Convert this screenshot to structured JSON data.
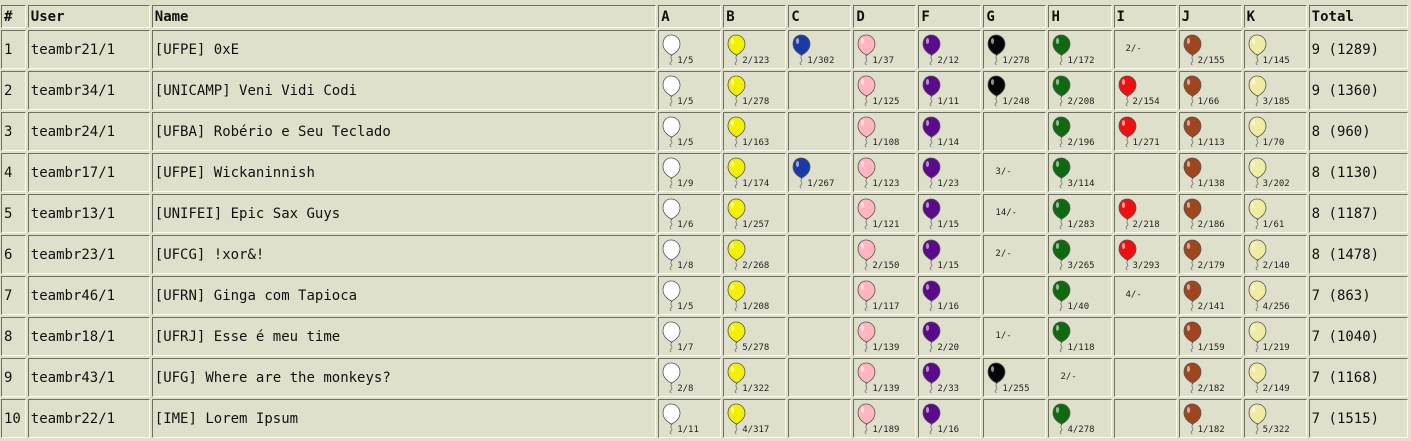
{
  "headers": {
    "rank": "#",
    "user": "User",
    "name": "Name",
    "total": "Total"
  },
  "problems": [
    {
      "letter": "A",
      "color": "#ffffff",
      "color_name": "white"
    },
    {
      "letter": "B",
      "color": "#f2f200",
      "color_name": "yellow"
    },
    {
      "letter": "C",
      "color": "#1a3aa8",
      "color_name": "blue"
    },
    {
      "letter": "D",
      "color": "#ffb6c1",
      "color_name": "pink"
    },
    {
      "letter": "F",
      "color": "#5a0a8a",
      "color_name": "purple"
    },
    {
      "letter": "G",
      "color": "#050505",
      "color_name": "black"
    },
    {
      "letter": "H",
      "color": "#0f6a0f",
      "color_name": "green"
    },
    {
      "letter": "I",
      "color": "#ee1010",
      "color_name": "red"
    },
    {
      "letter": "J",
      "color": "#a0461e",
      "color_name": "brown"
    },
    {
      "letter": "K",
      "color": "#f0eca4",
      "color_name": "light-yellow"
    }
  ],
  "rows": [
    {
      "rank": "1",
      "user": "teambr21/1",
      "name": "[UFPE] 0xE",
      "total": "9 (1289)",
      "cells": [
        {
          "solved": true,
          "text": "1/5"
        },
        {
          "solved": true,
          "text": "2/123"
        },
        {
          "solved": true,
          "text": "1/302"
        },
        {
          "solved": true,
          "text": "1/37"
        },
        {
          "solved": true,
          "text": "2/12"
        },
        {
          "solved": true,
          "text": "1/278"
        },
        {
          "solved": true,
          "text": "1/172"
        },
        {
          "solved": false,
          "text": "2/-"
        },
        {
          "solved": true,
          "text": "2/155"
        },
        {
          "solved": true,
          "text": "1/145"
        }
      ]
    },
    {
      "rank": "2",
      "user": "teambr34/1",
      "name": "[UNICAMP] Veni Vidi Codi",
      "total": "9 (1360)",
      "cells": [
        {
          "solved": true,
          "text": "1/5"
        },
        {
          "solved": true,
          "text": "1/278"
        },
        {
          "solved": false,
          "text": ""
        },
        {
          "solved": true,
          "text": "1/125"
        },
        {
          "solved": true,
          "text": "1/11"
        },
        {
          "solved": true,
          "text": "1/248"
        },
        {
          "solved": true,
          "text": "2/208"
        },
        {
          "solved": true,
          "text": "2/154"
        },
        {
          "solved": true,
          "text": "1/66"
        },
        {
          "solved": true,
          "text": "3/185"
        }
      ]
    },
    {
      "rank": "3",
      "user": "teambr24/1",
      "name": "[UFBA] Robério e Seu Teclado",
      "total": "8 (960)",
      "cells": [
        {
          "solved": true,
          "text": "1/5"
        },
        {
          "solved": true,
          "text": "1/163"
        },
        {
          "solved": false,
          "text": ""
        },
        {
          "solved": true,
          "text": "1/108"
        },
        {
          "solved": true,
          "text": "1/14"
        },
        {
          "solved": false,
          "text": ""
        },
        {
          "solved": true,
          "text": "2/196"
        },
        {
          "solved": true,
          "text": "1/271"
        },
        {
          "solved": true,
          "text": "1/113"
        },
        {
          "solved": true,
          "text": "1/70"
        }
      ]
    },
    {
      "rank": "4",
      "user": "teambr17/1",
      "name": "[UFPE] Wickaninnish",
      "total": "8 (1130)",
      "cells": [
        {
          "solved": true,
          "text": "1/9"
        },
        {
          "solved": true,
          "text": "1/174"
        },
        {
          "solved": true,
          "text": "1/267"
        },
        {
          "solved": true,
          "text": "1/123"
        },
        {
          "solved": true,
          "text": "1/23"
        },
        {
          "solved": false,
          "text": "3/-"
        },
        {
          "solved": true,
          "text": "3/114"
        },
        {
          "solved": false,
          "text": ""
        },
        {
          "solved": true,
          "text": "1/138"
        },
        {
          "solved": true,
          "text": "3/202"
        }
      ]
    },
    {
      "rank": "5",
      "user": "teambr13/1",
      "name": "[UNIFEI] Epic Sax Guys",
      "total": "8 (1187)",
      "cells": [
        {
          "solved": true,
          "text": "1/6"
        },
        {
          "solved": true,
          "text": "1/257"
        },
        {
          "solved": false,
          "text": ""
        },
        {
          "solved": true,
          "text": "1/121"
        },
        {
          "solved": true,
          "text": "1/15"
        },
        {
          "solved": false,
          "text": "14/-"
        },
        {
          "solved": true,
          "text": "1/283"
        },
        {
          "solved": true,
          "text": "2/218"
        },
        {
          "solved": true,
          "text": "2/186"
        },
        {
          "solved": true,
          "text": "1/61"
        }
      ]
    },
    {
      "rank": "6",
      "user": "teambr23/1",
      "name": "[UFCG] !xor&!",
      "total": "8 (1478)",
      "cells": [
        {
          "solved": true,
          "text": "1/8"
        },
        {
          "solved": true,
          "text": "2/268"
        },
        {
          "solved": false,
          "text": ""
        },
        {
          "solved": true,
          "text": "2/150"
        },
        {
          "solved": true,
          "text": "1/15"
        },
        {
          "solved": false,
          "text": "2/-"
        },
        {
          "solved": true,
          "text": "3/265"
        },
        {
          "solved": true,
          "text": "3/293"
        },
        {
          "solved": true,
          "text": "2/179"
        },
        {
          "solved": true,
          "text": "2/140"
        }
      ]
    },
    {
      "rank": "7",
      "user": "teambr46/1",
      "name": "[UFRN] Ginga com Tapioca",
      "total": "7 (863)",
      "cells": [
        {
          "solved": true,
          "text": "1/5"
        },
        {
          "solved": true,
          "text": "1/208"
        },
        {
          "solved": false,
          "text": ""
        },
        {
          "solved": true,
          "text": "1/117"
        },
        {
          "solved": true,
          "text": "1/16"
        },
        {
          "solved": false,
          "text": ""
        },
        {
          "solved": true,
          "text": "1/40"
        },
        {
          "solved": false,
          "text": "4/-"
        },
        {
          "solved": true,
          "text": "2/141"
        },
        {
          "solved": true,
          "text": "4/256"
        }
      ]
    },
    {
      "rank": "8",
      "user": "teambr18/1",
      "name": "[UFRJ] Esse é meu time",
      "total": "7 (1040)",
      "cells": [
        {
          "solved": true,
          "text": "1/7"
        },
        {
          "solved": true,
          "text": "5/278"
        },
        {
          "solved": false,
          "text": ""
        },
        {
          "solved": true,
          "text": "1/139"
        },
        {
          "solved": true,
          "text": "2/20"
        },
        {
          "solved": false,
          "text": "1/-"
        },
        {
          "solved": true,
          "text": "1/118"
        },
        {
          "solved": false,
          "text": ""
        },
        {
          "solved": true,
          "text": "1/159"
        },
        {
          "solved": true,
          "text": "1/219"
        }
      ]
    },
    {
      "rank": "9",
      "user": "teambr43/1",
      "name": "[UFG] Where are the monkeys?",
      "total": "7 (1168)",
      "cells": [
        {
          "solved": true,
          "text": "2/8"
        },
        {
          "solved": true,
          "text": "1/322"
        },
        {
          "solved": false,
          "text": ""
        },
        {
          "solved": true,
          "text": "1/139"
        },
        {
          "solved": true,
          "text": "2/33"
        },
        {
          "solved": true,
          "text": "1/255"
        },
        {
          "solved": false,
          "text": "2/-"
        },
        {
          "solved": false,
          "text": ""
        },
        {
          "solved": true,
          "text": "2/182"
        },
        {
          "solved": true,
          "text": "2/149"
        }
      ]
    },
    {
      "rank": "10",
      "user": "teambr22/1",
      "name": "[IME] Lorem Ipsum",
      "total": "7 (1515)",
      "cells": [
        {
          "solved": true,
          "text": "1/11"
        },
        {
          "solved": true,
          "text": "4/317"
        },
        {
          "solved": false,
          "text": ""
        },
        {
          "solved": true,
          "text": "1/189"
        },
        {
          "solved": true,
          "text": "1/16"
        },
        {
          "solved": false,
          "text": ""
        },
        {
          "solved": true,
          "text": "4/278"
        },
        {
          "solved": false,
          "text": ""
        },
        {
          "solved": true,
          "text": "1/182"
        },
        {
          "solved": true,
          "text": "5/322"
        }
      ]
    }
  ]
}
